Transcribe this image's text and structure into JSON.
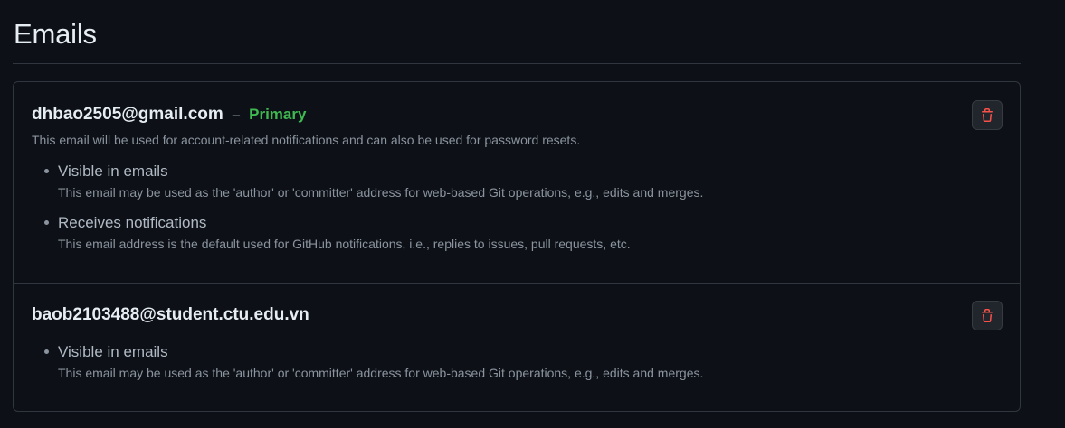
{
  "page": {
    "title": "Emails"
  },
  "emails": [
    {
      "address": "dhbao2505@gmail.com",
      "separator": "–",
      "primary_label": "Primary",
      "description": "This email will be used for account-related notifications and can also be used for password resets.",
      "properties": [
        {
          "title": "Visible in emails",
          "description": "This email may be used as the 'author' or 'committer' address for web-based Git operations, e.g., edits and merges."
        },
        {
          "title": "Receives notifications",
          "description": "This email address is the default used for GitHub notifications, i.e., replies to issues, pull requests, etc."
        }
      ],
      "delete_icon": "trash-icon"
    },
    {
      "address": "baob2103488@student.ctu.edu.vn",
      "properties": [
        {
          "title": "Visible in emails",
          "description": "This email may be used as the 'author' or 'committer' address for web-based Git operations, e.g., edits and merges."
        }
      ],
      "delete_icon": "trash-icon"
    }
  ],
  "colors": {
    "background": "#0d1117",
    "border": "#30363d",
    "primary_badge": "#3fb950",
    "danger_icon": "#f85149",
    "muted_text": "#8b949e"
  }
}
